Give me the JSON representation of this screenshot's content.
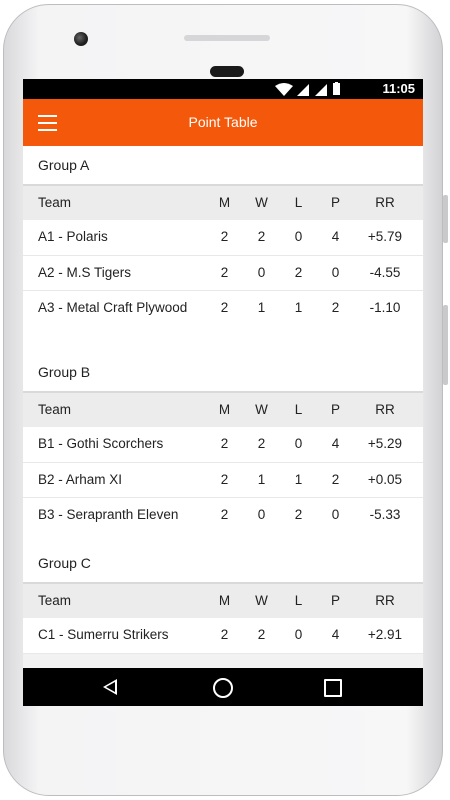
{
  "status": {
    "time": "11:05"
  },
  "appbar": {
    "title": "Point Table"
  },
  "header": {
    "team": "Team",
    "m": "M",
    "w": "W",
    "l": "L",
    "p": "P",
    "rr": "RR"
  },
  "groups": [
    {
      "title": "Group A",
      "rows": [
        {
          "team": "A1 - Polaris",
          "m": "2",
          "w": "2",
          "l": "0",
          "p": "4",
          "rr": "+5.79"
        },
        {
          "team": "A2 - M.S Tigers",
          "m": "2",
          "w": "0",
          "l": "2",
          "p": "0",
          "rr": "-4.55"
        },
        {
          "team": "A3 - Metal Craft Plywood",
          "m": "2",
          "w": "1",
          "l": "1",
          "p": "2",
          "rr": "-1.10"
        }
      ]
    },
    {
      "title": "Group B",
      "rows": [
        {
          "team": "B1 - Gothi Scorchers",
          "m": "2",
          "w": "2",
          "l": "0",
          "p": "4",
          "rr": "+5.29"
        },
        {
          "team": "B2 - Arham XI",
          "m": "2",
          "w": "1",
          "l": "1",
          "p": "2",
          "rr": "+0.05"
        },
        {
          "team": "B3 - Serapranth Eleven",
          "m": "2",
          "w": "0",
          "l": "2",
          "p": "0",
          "rr": "-5.33"
        }
      ]
    },
    {
      "title": "Group C",
      "rows": [
        {
          "team": "C1 - Sumerru Strikers",
          "m": "2",
          "w": "2",
          "l": "0",
          "p": "4",
          "rr": "+2.91"
        }
      ]
    }
  ],
  "colors": {
    "accent": "#f4580b",
    "header_bg": "#ececec"
  }
}
